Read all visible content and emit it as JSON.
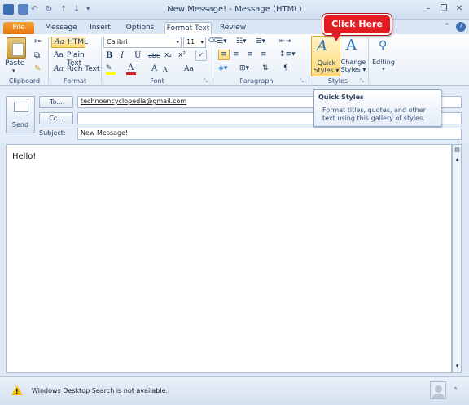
{
  "window": {
    "title": "New Message! - Message (HTML)",
    "controls": [
      "minimize-icon",
      "restore-icon",
      "close-icon"
    ]
  },
  "tabs": [
    "File",
    "Message",
    "Insert",
    "Options",
    "Format Text",
    "Review"
  ],
  "active_tab": "Format Text",
  "ribbon": {
    "clipboard": {
      "paste_label": "Paste",
      "group_label": "Clipboard"
    },
    "format": {
      "html_label": "HTML",
      "plain_label": "Plain Text",
      "rich_label": "Rich Text",
      "group_label": "Format"
    },
    "font": {
      "font_name": "Calibri",
      "font_size": "11",
      "bold": "B",
      "italic": "I",
      "underline": "U",
      "strike": "abc",
      "subscript": "x₂",
      "superscript": "x²",
      "grow": "A",
      "shrink": "A",
      "change_case": "Aa",
      "group_label": "Font"
    },
    "paragraph": {
      "group_label": "Paragraph"
    },
    "styles": {
      "quick_styles_line1": "Quick",
      "quick_styles_line2": "Styles",
      "change_styles_line1": "Change",
      "change_styles_line2": "Styles",
      "group_label": "Styles"
    },
    "editing": {
      "label": "Editing"
    }
  },
  "callout": {
    "text": "Click Here"
  },
  "tooltip": {
    "title": "Quick Styles",
    "description": "Format titles, quotes, and other text using this gallery of styles."
  },
  "header": {
    "send_label": "Send",
    "to_label": "To...",
    "cc_label": "Cc...",
    "subject_label": "Subject:",
    "to_value": "technoencyclopedia@gmail.com",
    "cc_value": "",
    "subject_value": "New Message!"
  },
  "body": {
    "text": "Hello!"
  },
  "status": {
    "text": "Windows Desktop Search is not available."
  },
  "colors": {
    "accent": "#e8750f",
    "callout": "#e31b23",
    "highlight": "#ffd876"
  }
}
